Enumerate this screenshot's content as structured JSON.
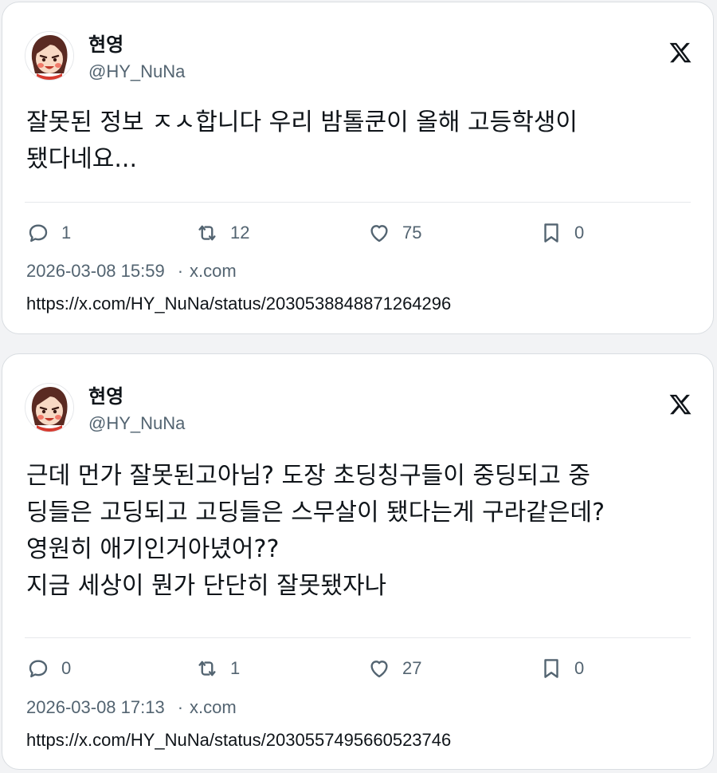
{
  "tweets": [
    {
      "name": "현영",
      "handle": "@HY_NuNa",
      "text": "잘못된 정보 ㅈㅅ합니다 우리 밤톨쿤이 올해 고등학생이\n됐다네요...",
      "replies": "1",
      "retweets": "12",
      "likes": "75",
      "bookmarks": "0",
      "timestamp": "2026-03-08 15:59",
      "source": "x.com",
      "url": "https://x.com/HY_NuNa/status/2030538848871264296"
    },
    {
      "name": "현영",
      "handle": "@HY_NuNa",
      "text": "근데 먼가 잘못된고아님? 도장 초딩칭구들이 중딩되고 중\n딩들은 고딩되고 고딩들은 스무살이 됐다는게 구라같은데?\n영원히 애기인거아녔어??\n지금 세상이 뭔가 단단히 잘못됐자나",
      "replies": "0",
      "retweets": "1",
      "likes": "27",
      "bookmarks": "0",
      "timestamp": "2026-03-08 17:13",
      "source": "x.com",
      "url": "https://x.com/HY_NuNa/status/2030557495660523746"
    }
  ],
  "meta_separator": "·",
  "icons": {
    "reply": "reply-icon",
    "retweet": "retweet-icon",
    "like": "heart-icon",
    "bookmark": "bookmark-icon",
    "brand": "x-logo-icon"
  },
  "colors": {
    "text": "#0f1419",
    "muted": "#536471",
    "border": "#d9dde1"
  }
}
